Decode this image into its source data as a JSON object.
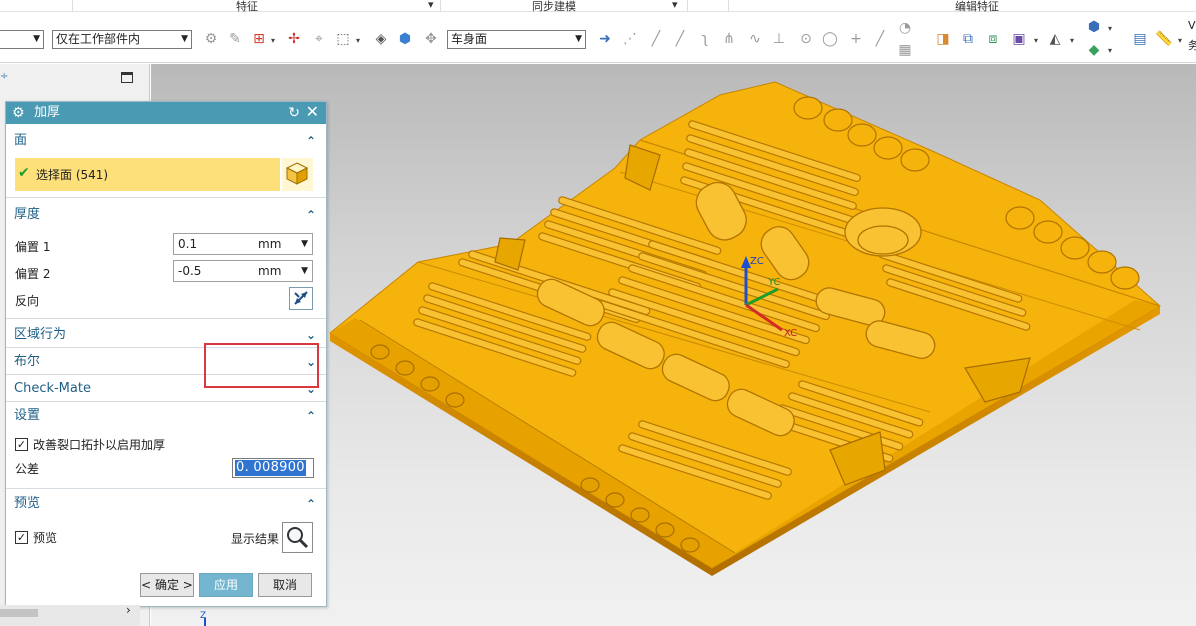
{
  "ribbon_groups": {
    "feature": "特征",
    "sync_modeling": "同步建模",
    "edit_feature": "编辑特征"
  },
  "toolbar": {
    "filter_combo_value": "仅在工作部件内",
    "face_rule_value": "车身面",
    "right_edge_text_1": "V",
    "right_edge_text_2": "务"
  },
  "dialog": {
    "title": "加厚",
    "face_section": {
      "header": "面",
      "select_label": "选择面 (541)"
    },
    "thickness_section": {
      "header": "厚度",
      "offset1_label": "偏置 1",
      "offset1_value": "0.1",
      "offset1_unit": "mm",
      "offset2_label": "偏置 2",
      "offset2_value": "-0.5",
      "offset2_unit": "mm",
      "reverse_label": "反向"
    },
    "region_behavior_header": "区域行为",
    "boolean_header": "布尔",
    "checkmate_header": "Check-Mate",
    "settings_section": {
      "header": "设置",
      "improve_topology_label": "改善裂口拓扑以启用加厚",
      "improve_topology_checked": true,
      "tolerance_label": "公差",
      "tolerance_value": "0. 008900"
    },
    "preview_section": {
      "header": "预览",
      "preview_label": "预览",
      "preview_checked": true,
      "show_result_label": "显示结果"
    },
    "buttons": {
      "ok": "< 确定 >",
      "apply": "应用",
      "cancel": "取消"
    }
  },
  "viewport": {
    "axis_x_label": "XC",
    "axis_y_label": "YC",
    "axis_z_label": "ZC",
    "triad_z_label": "Z",
    "model_color": "#f5b30c"
  },
  "colors": {
    "dialog_title_bar": "#4b9ab3",
    "selection_highlight": "#fde07a",
    "apply_button": "#74b6d0",
    "callout_red": "#d9393e",
    "section_header_text": "#1f5f86"
  }
}
